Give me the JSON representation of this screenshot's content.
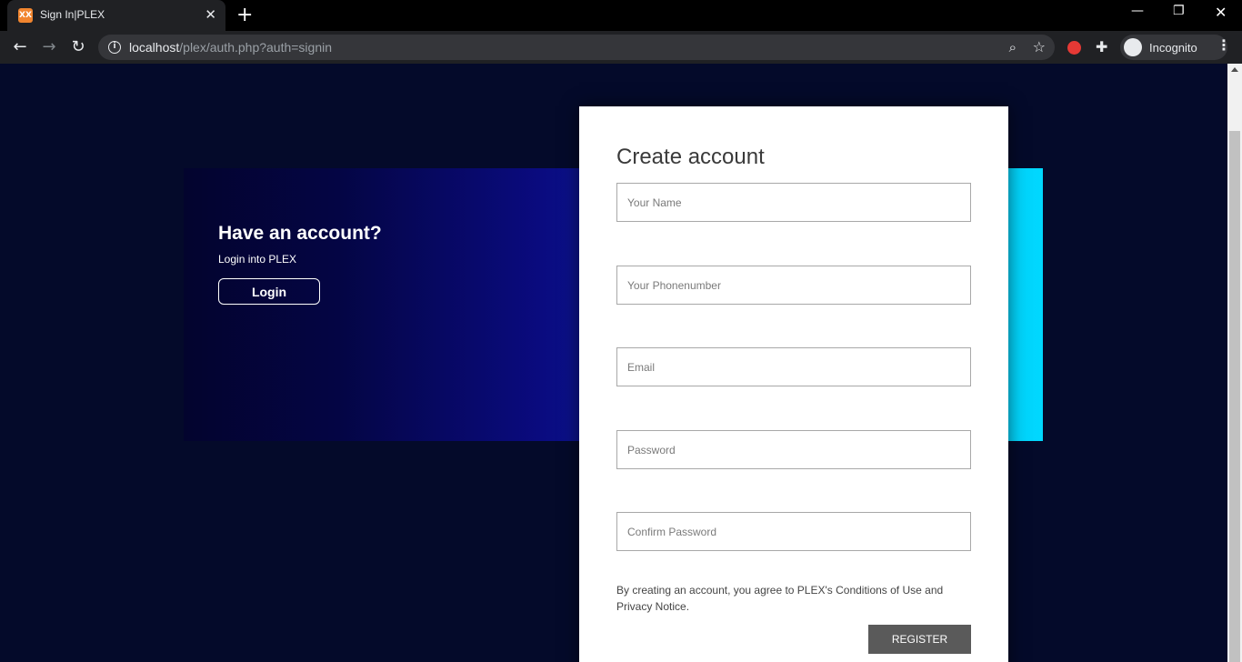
{
  "browser": {
    "tab_title": "Sign In|PLEX",
    "favicon_text": "XX",
    "url_host": "localhost",
    "url_path": "/plex/auth.php?auth=signin",
    "profile_label": "Incognito"
  },
  "banner": {
    "title": "Have an account?",
    "subtitle": "Login into PLEX",
    "login_label": "Login"
  },
  "form": {
    "title": "Create account",
    "fields": [
      {
        "placeholder": "Your Name",
        "value": ""
      },
      {
        "placeholder": "Your Phonenumber",
        "value": ""
      },
      {
        "placeholder": "Email",
        "value": ""
      },
      {
        "placeholder": "Password",
        "value": ""
      },
      {
        "placeholder": "Confirm Password",
        "value": ""
      }
    ],
    "terms": "By creating an account, you agree to PLEX's Conditions of Use and Privacy Notice.",
    "register_label": "REGISTER"
  },
  "colors": {
    "page_bg": "#040a2a",
    "button_bg": "#5a5a5a",
    "gradient_end": "#00d8ff"
  }
}
